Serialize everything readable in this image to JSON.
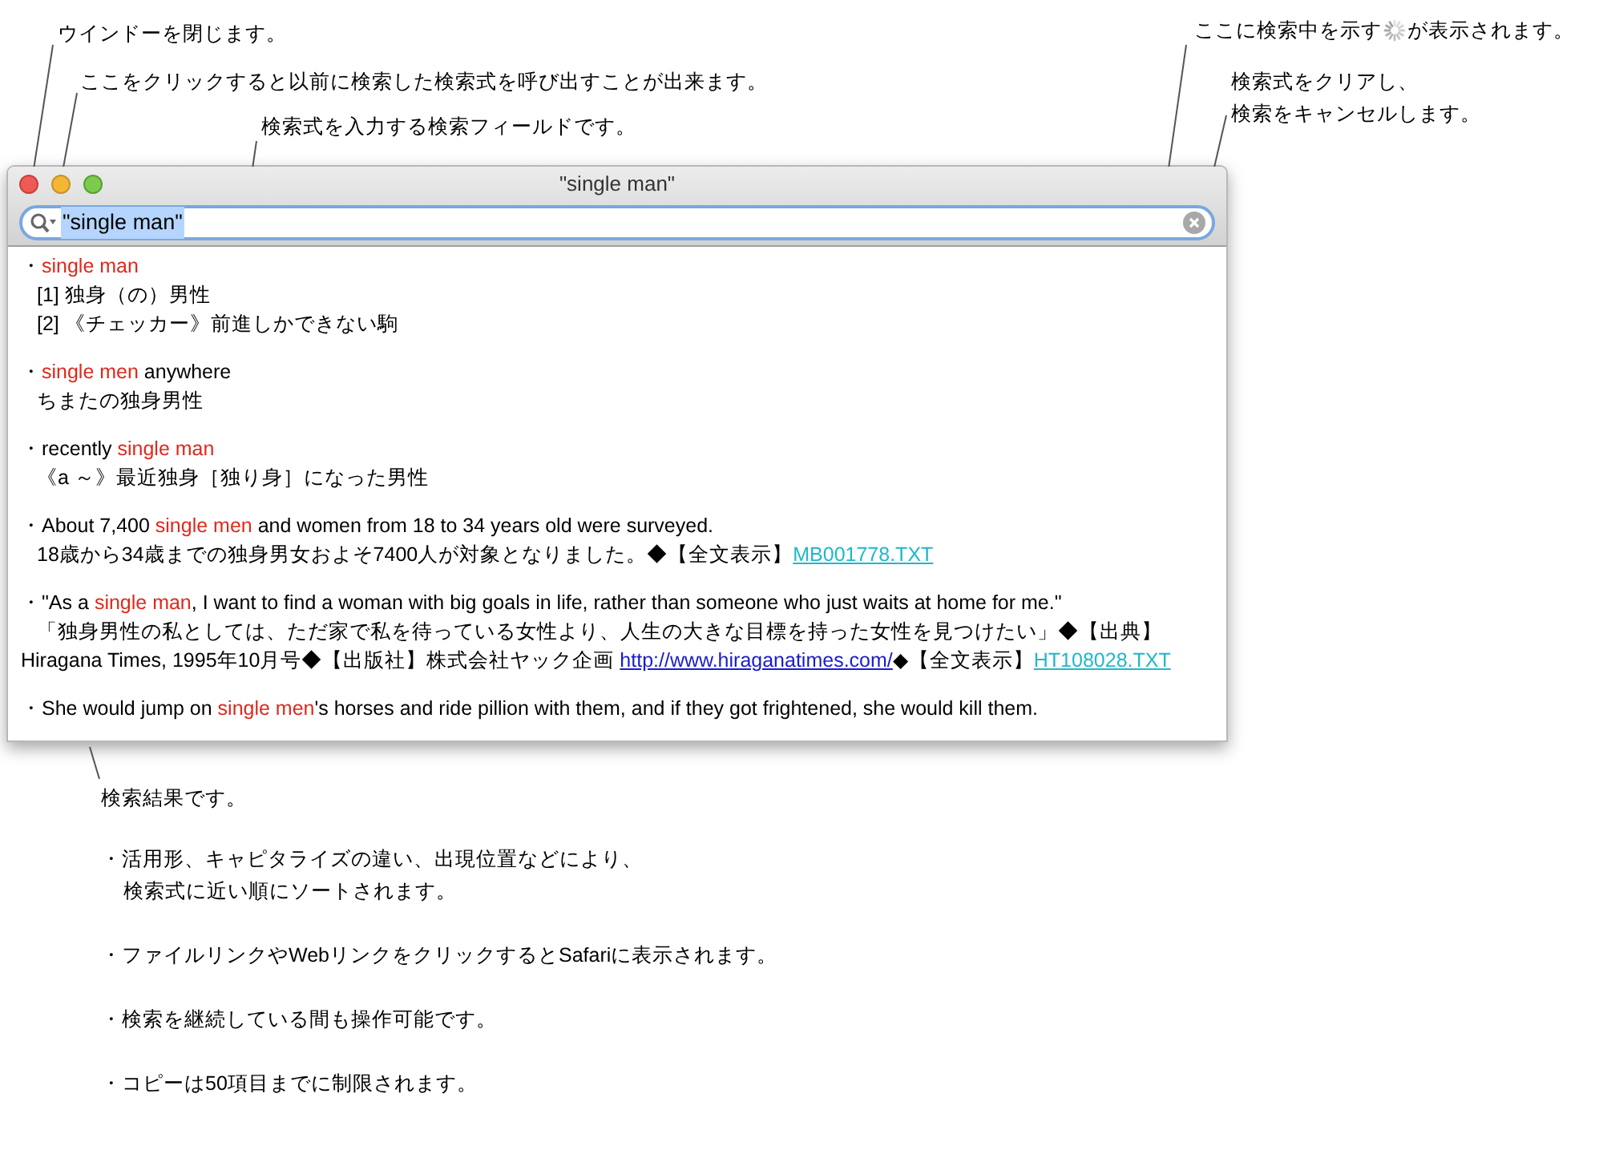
{
  "annotations": [
    {
      "text": "ウインドーを閉じます。"
    },
    {
      "text": "ここをクリックすると以前に検索した検索式を呼び出すことが出来ます。"
    },
    {
      "text": "検索式を入力する検索フィールドです。"
    },
    {
      "before": "ここに検索中を示す",
      "after": "が表示されます。"
    },
    {
      "lines": [
        "検索式をクリアし、",
        "検索をキャンセルします。"
      ]
    },
    {
      "text": "検索結果です。"
    }
  ],
  "window": {
    "title": "\"single man\"",
    "search": {
      "value": "\"single man\"",
      "selected": true
    },
    "results": [
      {
        "lines": [
          [
            {
              "kind": "plain",
              "text": "・"
            },
            {
              "kind": "hit",
              "text": "single man"
            }
          ],
          [
            {
              "kind": "plain",
              "text": "[1] 独身（の）男性"
            }
          ],
          [
            {
              "kind": "plain",
              "text": "[2] 《チェッカー》前進しかできない駒"
            }
          ]
        ]
      },
      {
        "lines": [
          [
            {
              "kind": "plain",
              "text": "・"
            },
            {
              "kind": "hit",
              "text": "single men"
            },
            {
              "kind": "plain",
              "text": " anywhere"
            }
          ],
          [
            {
              "kind": "plain",
              "text": "ちまたの独身男性"
            }
          ]
        ]
      },
      {
        "lines": [
          [
            {
              "kind": "plain",
              "text": "・recently "
            },
            {
              "kind": "hit",
              "text": "single man"
            }
          ],
          [
            {
              "kind": "plain",
              "text": "《a ～》最近独身［独り身］になった男性"
            }
          ]
        ]
      },
      {
        "lines": [
          [
            {
              "kind": "plain",
              "text": "・About 7,400 "
            },
            {
              "kind": "hit",
              "text": "single men"
            },
            {
              "kind": "plain",
              "text": " and women from 18 to 34 years old were surveyed."
            }
          ],
          [
            {
              "kind": "plain",
              "text": "18歳から34歳までの独身男女およそ7400人が対象となりました。◆【全文表示】"
            },
            {
              "kind": "filelink",
              "text": "MB001778.TXT"
            }
          ]
        ]
      },
      {
        "lines": [
          [
            {
              "kind": "plain",
              "text": "・\"As a "
            },
            {
              "kind": "hit",
              "text": "single man"
            },
            {
              "kind": "plain",
              "text": ", I want to find a woman with big goals in life, rather than someone who just waits at home for me.\""
            }
          ],
          [
            {
              "kind": "plain",
              "text": "「独身男性の私としては、ただ家で私を待っている女性より、人生の大きな目標を持った女性を見つけたい」◆【出典】Hiragana Times, 1995年10月号◆【出版社】株式会社ヤック企画 "
            },
            {
              "kind": "weblink",
              "text": "http://www.hiraganatimes.com/"
            },
            {
              "kind": "plain",
              "text": "◆【全文表示】"
            },
            {
              "kind": "filelink",
              "text": "HT108028.TXT"
            }
          ]
        ]
      },
      {
        "lines": [
          [
            {
              "kind": "plain",
              "text": "・She would jump on "
            },
            {
              "kind": "hit",
              "text": "single men"
            },
            {
              "kind": "plain",
              "text": "'s horses and ride pillion with them, and if they got frightened, she would kill them."
            }
          ]
        ]
      }
    ]
  },
  "notes": [
    {
      "lines": [
        "・活用形、キャピタライズの違い、出現位置などにより、",
        "検索式に近い順にソートされます。"
      ]
    },
    {
      "lines": [
        "・ファイルリンクやWebリンクをクリックするとSafariに表示されます。"
      ]
    },
    {
      "lines": [
        "・検索を継続している間も操作可能です。"
      ]
    },
    {
      "lines": [
        "・コピーは50項目までに制限されます。"
      ]
    }
  ]
}
